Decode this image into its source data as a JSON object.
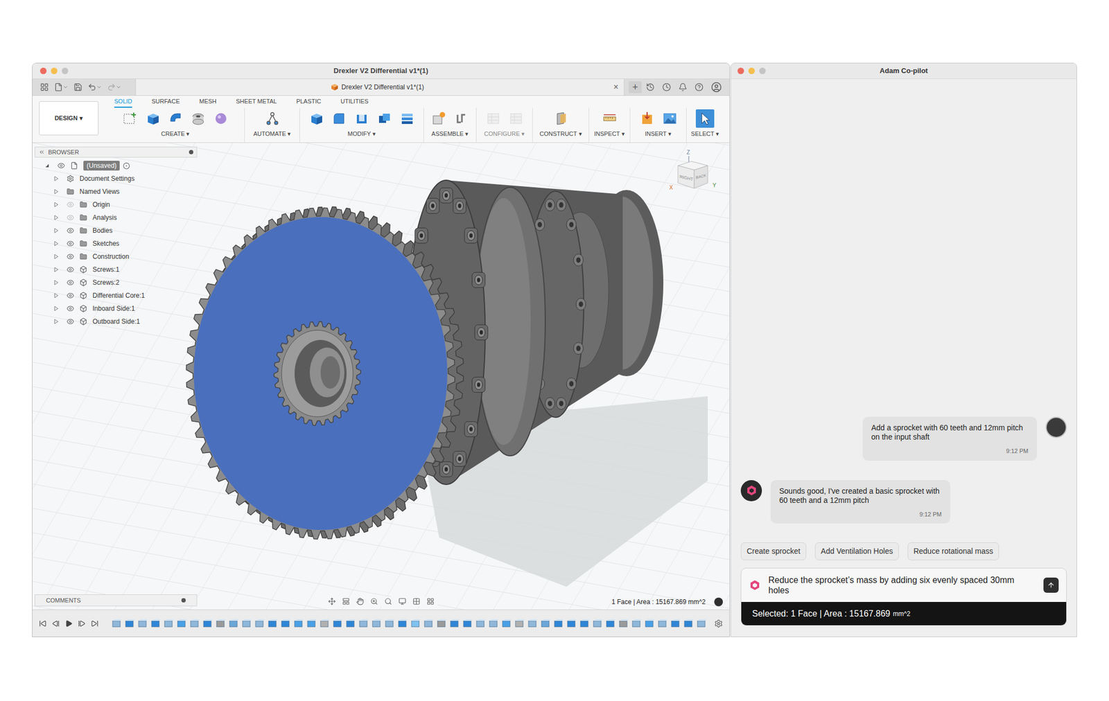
{
  "cad": {
    "window": {
      "title": "Drexler V2 Differential v1*(1)"
    },
    "document_tab": {
      "title": "Drexler V2 Differential v1*(1)",
      "close": "×",
      "new_tab": "+"
    },
    "workspace": {
      "label": "DESIGN",
      "caret": "▾"
    },
    "toolbar_tabs": [
      {
        "label": "SOLID",
        "selected": true
      },
      {
        "label": "SURFACE",
        "selected": false
      },
      {
        "label": "MESH",
        "selected": false
      },
      {
        "label": "SHEET METAL",
        "selected": false
      },
      {
        "label": "PLASTIC",
        "selected": false
      },
      {
        "label": "UTILITIES",
        "selected": false
      }
    ],
    "toolbar_groups": [
      {
        "label": "CREATE",
        "caret": "▾",
        "selected": false,
        "disabled": false
      },
      {
        "label": "AUTOMATE",
        "caret": "▾",
        "selected": false,
        "disabled": false
      },
      {
        "label": "MODIFY",
        "caret": "▾",
        "selected": false,
        "disabled": false
      },
      {
        "label": "ASSEMBLE",
        "caret": "▾",
        "selected": false,
        "disabled": false
      },
      {
        "label": "CONFIGURE",
        "caret": "▾",
        "selected": false,
        "disabled": true
      },
      {
        "label": "CONSTRUCT",
        "caret": "▾",
        "selected": false,
        "disabled": false
      },
      {
        "label": "INSPECT",
        "caret": "▾",
        "selected": false,
        "disabled": false
      },
      {
        "label": "INSERT",
        "caret": "▾",
        "selected": false,
        "disabled": false
      },
      {
        "label": "SELECT",
        "caret": "▾",
        "selected": true,
        "disabled": false
      }
    ],
    "browser": {
      "title": "BROWSER",
      "items": [
        {
          "label": "(Unsaved)",
          "kind": "root",
          "visibility": "visible",
          "expanded": true,
          "selected": true
        },
        {
          "label": "Document Settings",
          "kind": "settings",
          "visibility": "none",
          "expanded": false,
          "selected": false
        },
        {
          "label": "Named Views",
          "kind": "folder",
          "visibility": "none",
          "expanded": false,
          "selected": false
        },
        {
          "label": "Origin",
          "kind": "folder",
          "visibility": "hidden",
          "expanded": false,
          "selected": false
        },
        {
          "label": "Analysis",
          "kind": "folder",
          "visibility": "hidden",
          "expanded": false,
          "selected": false
        },
        {
          "label": "Bodies",
          "kind": "folder",
          "visibility": "visible",
          "expanded": false,
          "selected": false
        },
        {
          "label": "Sketches",
          "kind": "folder",
          "visibility": "visible",
          "expanded": false,
          "selected": false
        },
        {
          "label": "Construction",
          "kind": "folder",
          "visibility": "visible",
          "expanded": false,
          "selected": false
        },
        {
          "label": "Screws:1",
          "kind": "component",
          "visibility": "visible",
          "expanded": false,
          "selected": false
        },
        {
          "label": "Screws:2",
          "kind": "component",
          "visibility": "visible",
          "expanded": false,
          "selected": false
        },
        {
          "label": "Differential Core:1",
          "kind": "component",
          "visibility": "visible",
          "expanded": false,
          "selected": false
        },
        {
          "label": "Inboard Side:1",
          "kind": "component",
          "visibility": "visible",
          "expanded": false,
          "selected": false
        },
        {
          "label": "Outboard Side:1",
          "kind": "component",
          "visibility": "visible",
          "expanded": false,
          "selected": false
        }
      ]
    },
    "viewcube": {
      "faces": [
        "RIGHT",
        "BACK"
      ],
      "axes": {
        "z": "Z",
        "x": "X",
        "y": "Y"
      }
    },
    "comments": {
      "title": "COMMENTS"
    },
    "status": "1 Face | Area : 15167.869 mm^2"
  },
  "copilot": {
    "window": {
      "title": "Adam Co-pilot"
    },
    "messages": [
      {
        "role": "user",
        "text": "Add a sprocket with 60 teeth and 12mm pitch on the input shaft",
        "time": "9:12 PM"
      },
      {
        "role": "assistant",
        "text": "Sounds good, I've created a basic sprocket with 60 teeth and a 12mm pitch",
        "time": "9:12 PM"
      }
    ],
    "suggestions": [
      "Create sprocket",
      "Add Ventilation Holes",
      "Reduce rotational mass"
    ],
    "input": {
      "value": "Reduce the sprocket’s mass by adding six evenly spaced 30mm holes"
    },
    "selection": {
      "text": "Selected: 1 Face | Area : 15167.869",
      "unit": "mm^2"
    }
  }
}
